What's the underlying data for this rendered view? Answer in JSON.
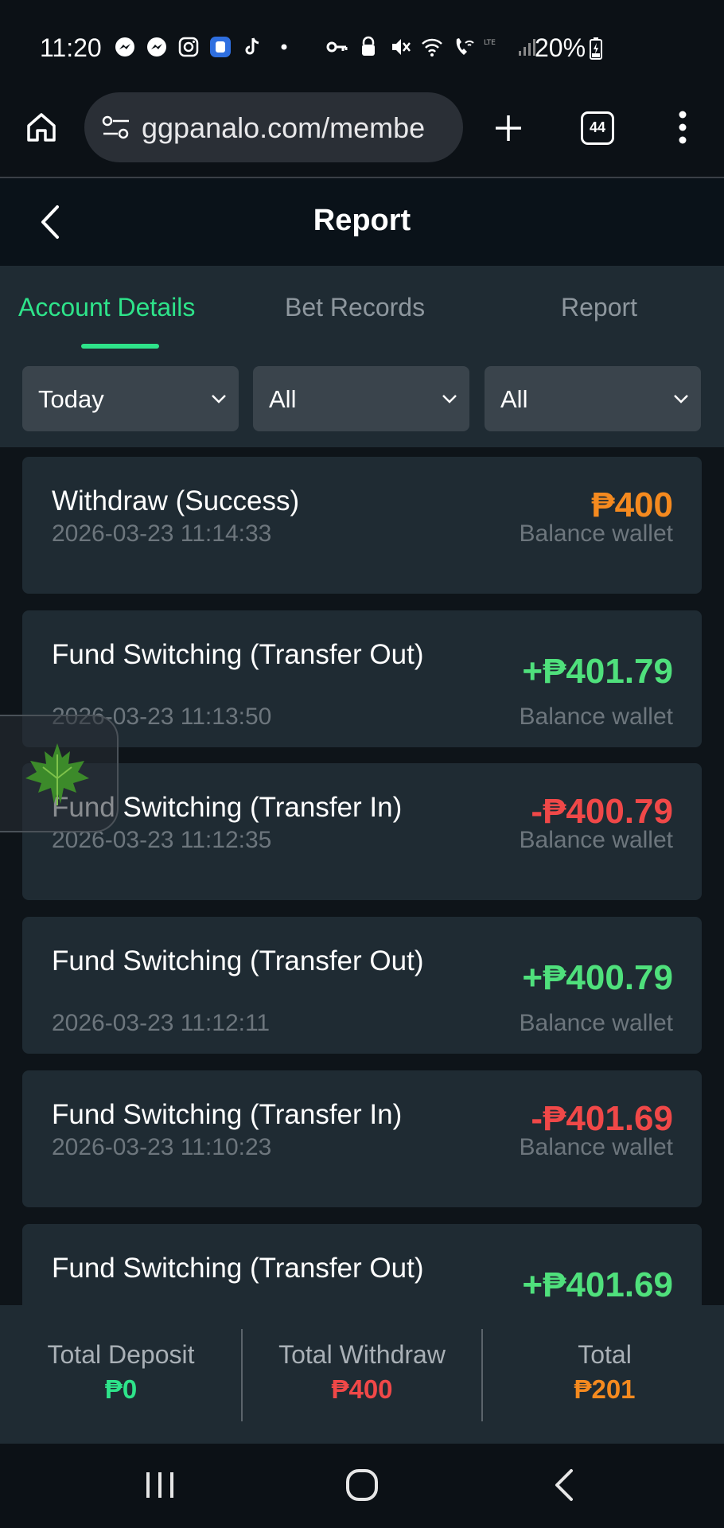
{
  "status_bar": {
    "time": "11:20",
    "battery": "20%"
  },
  "browser": {
    "url": "ggpanalo.com/membe",
    "tab_count": "44"
  },
  "header": {
    "title": "Report"
  },
  "tabs": [
    {
      "label": "Account Details",
      "active": true
    },
    {
      "label": "Bet Records",
      "active": false
    },
    {
      "label": "Report",
      "active": false
    }
  ],
  "filters": {
    "date": "Today",
    "type": "All",
    "status": "All"
  },
  "transactions": [
    {
      "title": "Withdraw (Success)",
      "date": "2026-03-23 11:14:33",
      "amount": "₱400",
      "wallet": "Balance wallet",
      "color": "#f58a1f"
    },
    {
      "title": "Fund Switching (Transfer Out)",
      "date": "2026-03-23 11:13:50",
      "amount": "+₱401.79",
      "wallet": "Balance wallet",
      "color": "#4fe07c"
    },
    {
      "title": "Fund Switching (Transfer In)",
      "date": "2026-03-23 11:12:35",
      "amount": "-₱400.79",
      "wallet": "Balance wallet",
      "color": "#f04848"
    },
    {
      "title": "Fund Switching (Transfer Out)",
      "date": "2026-03-23 11:12:11",
      "amount": "+₱400.79",
      "wallet": "Balance wallet",
      "color": "#4fe07c"
    },
    {
      "title": "Fund Switching (Transfer In)",
      "date": "2026-03-23 11:10:23",
      "amount": "-₱401.69",
      "wallet": "Balance wallet",
      "color": "#f04848"
    },
    {
      "title": "Fund Switching (Transfer Out)",
      "date": "",
      "amount": "+₱401.69",
      "wallet": "",
      "color": "#4fe07c"
    }
  ],
  "totals": {
    "deposit_label": "Total Deposit",
    "deposit_value": "₱0",
    "withdraw_label": "Total Withdraw",
    "withdraw_value": "₱400",
    "total_label": "Total",
    "total_value": "₱201"
  },
  "colors": {
    "accent_green": "#2ee38a",
    "withdraw_red": "#f04848",
    "total_orange": "#f58a1f"
  }
}
